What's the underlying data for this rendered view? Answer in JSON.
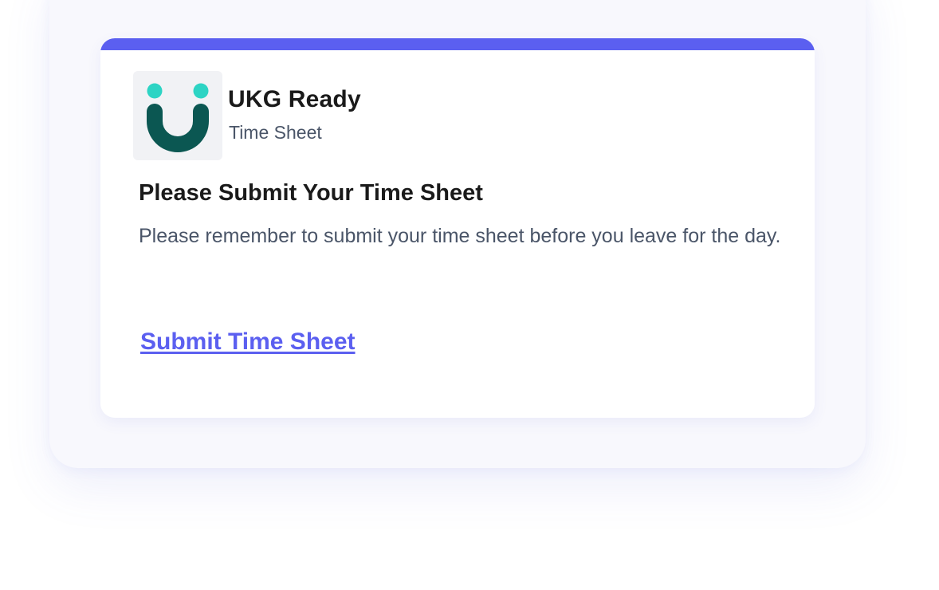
{
  "notification": {
    "app_name": "UKG Ready",
    "app_subtitle": "Time Sheet",
    "title": "Please Submit Your Time Sheet",
    "body": "Please remember to submit your time sheet before you leave for the day.",
    "action_label": "Submit Time Sheet",
    "logo_icon": "ukg-smile-logo-icon"
  },
  "colors": {
    "accent": "#5b5ff0",
    "logo_dots": "#2dd4c4",
    "logo_arc": "#0b5752",
    "logo_tile": "#f1f2f5",
    "title_text": "#1a1a1a",
    "secondary_text": "#4a5568"
  }
}
